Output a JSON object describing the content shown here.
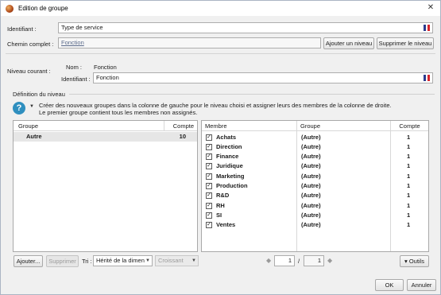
{
  "window": {
    "title": "Edition de groupe",
    "close_glyph": "✕"
  },
  "identifiant": {
    "label": "Identifiant :",
    "value": "Type de service"
  },
  "chemin": {
    "label": "Chemin complet :",
    "value": "Fonction",
    "add_level_label": "Ajouter un niveau",
    "remove_level_label": "Supprimer le niveau"
  },
  "niveau": {
    "label": "Niveau courant :",
    "nom_label": "Nom :",
    "nom_value": "Fonction",
    "id_label": "Identifiant :",
    "id_value": "Fonction"
  },
  "definition": {
    "legend": "Définition du niveau",
    "help_line1": "Créer des nouveaux groupes dans la colonne de gauche pour le niveau choisi et assigner leurs des membres de la colonne de droite.",
    "help_line2": "Le premier groupe contient tous les membres non assignés."
  },
  "groups_table": {
    "headers": {
      "groupe": "Groupe",
      "compte": "Compte"
    },
    "rows": [
      {
        "groupe": "Autre",
        "compte": "10"
      }
    ]
  },
  "members_table": {
    "headers": {
      "membre": "Membre",
      "groupe": "Groupe",
      "compte": "Compte"
    },
    "rows": [
      {
        "membre": "Achats",
        "groupe": "(Autre)",
        "compte": "1",
        "checked": true
      },
      {
        "membre": "Direction",
        "groupe": "(Autre)",
        "compte": "1",
        "checked": true
      },
      {
        "membre": "Finance",
        "groupe": "(Autre)",
        "compte": "1",
        "checked": true
      },
      {
        "membre": "Juridique",
        "groupe": "(Autre)",
        "compte": "1",
        "checked": true
      },
      {
        "membre": "Marketing",
        "groupe": "(Autre)",
        "compte": "1",
        "checked": true
      },
      {
        "membre": "Production",
        "groupe": "(Autre)",
        "compte": "1",
        "checked": true
      },
      {
        "membre": "R&D",
        "groupe": "(Autre)",
        "compte": "1",
        "checked": true
      },
      {
        "membre": "RH",
        "groupe": "(Autre)",
        "compte": "1",
        "checked": true
      },
      {
        "membre": "SI",
        "groupe": "(Autre)",
        "compte": "1",
        "checked": true
      },
      {
        "membre": "Ventes",
        "groupe": "(Autre)",
        "compte": "1",
        "checked": true
      }
    ]
  },
  "bottom_left": {
    "add_label": "Ajouter...",
    "delete_label": "Supprimer",
    "sort_label": "Tri :",
    "sort_value": "Hérité de la dimen",
    "order_value": "Croissant"
  },
  "pagination": {
    "current": "1",
    "separator": "/",
    "total": "1"
  },
  "tools": {
    "label": "▾ Outils"
  },
  "footer": {
    "ok_label": "OK",
    "cancel_label": "Annuler"
  },
  "colors": {
    "accent_help": "#2f8fbf",
    "flag_blue": "#2a3d8f",
    "flag_white": "#ffffff",
    "flag_red": "#d8262c"
  }
}
